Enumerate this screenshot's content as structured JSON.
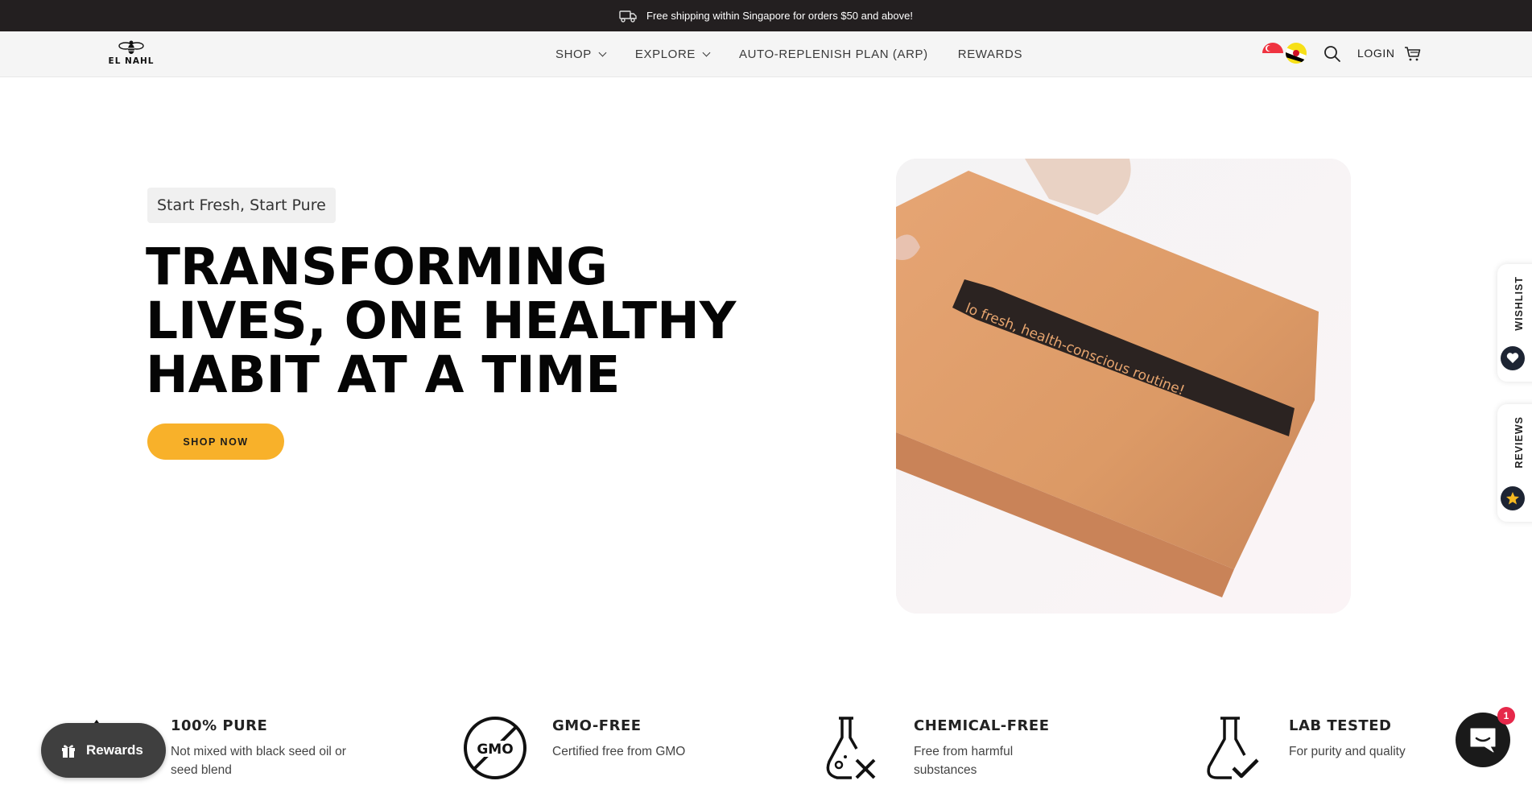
{
  "announcement": {
    "text": "Free shipping within Singapore for orders $50 and above!",
    "icon": "truck-icon"
  },
  "header": {
    "logo_text": "EL NAHL",
    "nav": [
      {
        "label": "SHOP",
        "has_dropdown": true
      },
      {
        "label": "EXPLORE",
        "has_dropdown": true
      },
      {
        "label": "AUTO-REPLENISH PLAN (ARP)",
        "has_dropdown": false
      },
      {
        "label": "REWARDS",
        "has_dropdown": false
      }
    ],
    "login_label": "LOGIN",
    "icons": [
      "singapore-flag-icon",
      "brunei-flag-icon",
      "search-icon",
      "cart-icon"
    ]
  },
  "hero": {
    "tag": "Start Fresh, Start Pure",
    "title_lines": [
      "TRANSFORMING",
      "LIVES, ONE HEALTHY",
      "HABIT AT A TIME"
    ],
    "button_label": "SHOP NOW",
    "image_alt_text_on_box": "lo fresh, health-conscious routine!"
  },
  "side_tabs": {
    "wishlist": "WISHLIST",
    "reviews": "REVIEWS"
  },
  "features": [
    {
      "title": "100% PURE",
      "desc": "Not mixed with black seed oil or seed blend",
      "icon": "pure-icon"
    },
    {
      "title": "GMO-FREE",
      "desc": "Certified free from GMO",
      "icon": "gmo-free-icon",
      "icon_text": "GMO"
    },
    {
      "title": "CHEMICAL-FREE",
      "desc": "Free from harmful substances",
      "icon": "flask-x-icon"
    },
    {
      "title": "LAB TESTED",
      "desc": "For purity and quality",
      "icon": "flask-check-icon"
    }
  ],
  "widgets": {
    "rewards_label": "Rewards",
    "chat_badge": "1"
  },
  "colors": {
    "announcement_bg": "#231f20",
    "header_bg": "#f5f5f5",
    "accent": "#f8b12a",
    "rewards_bg": "#3f3f3f",
    "badge": "#e6284a"
  }
}
